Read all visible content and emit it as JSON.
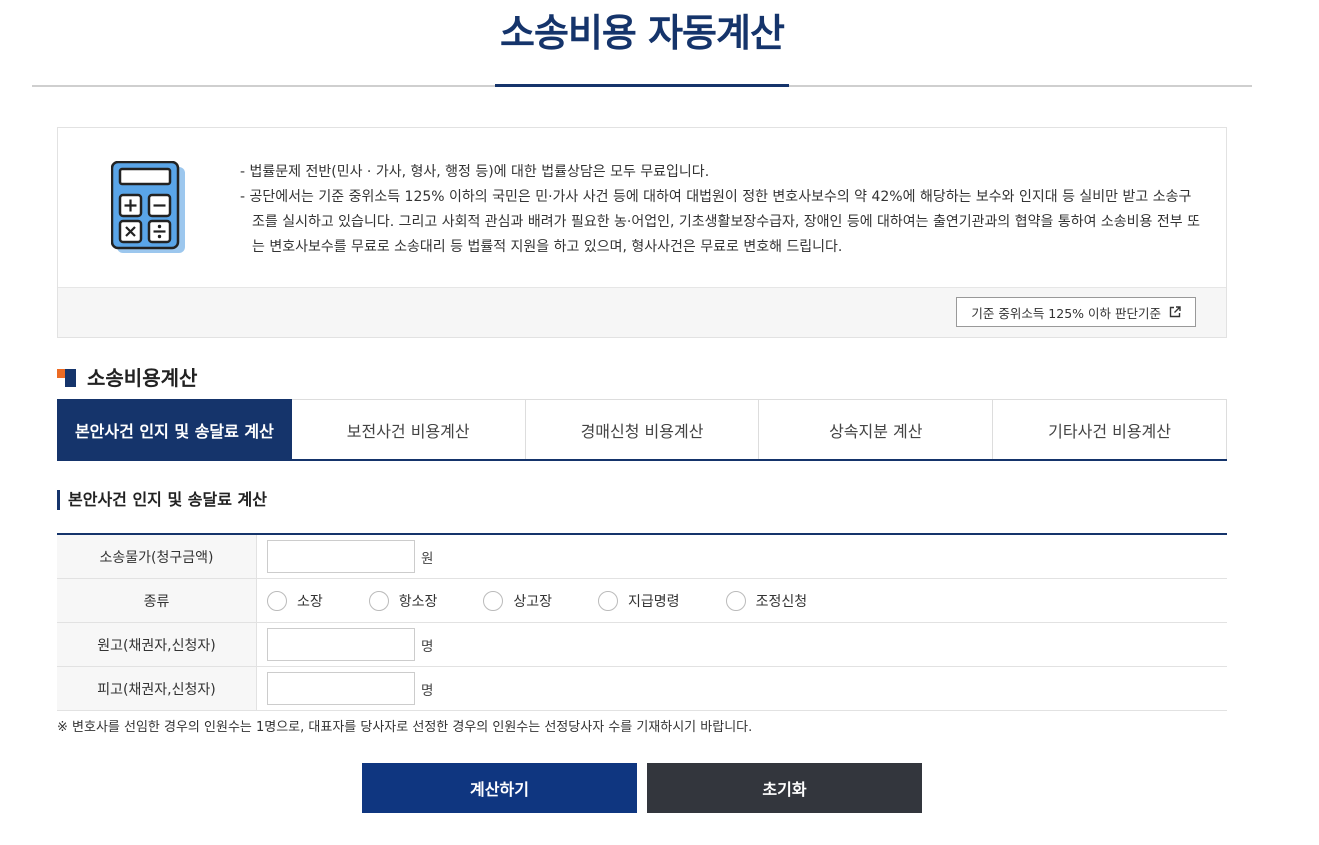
{
  "page": {
    "title": "소송비용 자동계산"
  },
  "info": {
    "line1": "법률문제 전반(민사 · 가사, 형사, 행정 등)에 대한 법률상담은 모두 무료입니다.",
    "line2": "공단에서는 기준 중위소득 125% 이하의 국민은 민·가사 사건 등에 대하여 대법원이 정한 변호사보수의 약 42%에 해당하는 보수와 인지대 등 실비만 받고 소송구조를 실시하고 있습니다. 그리고 사회적 관심과 배려가 필요한 농·어업인, 기초생활보장수급자, 장애인 등에 대하여는 출연기관과의 협약을 통하여 소송비용 전부 또는 변호사보수를 무료로 소송대리 등 법률적 지원을 하고 있으며, 형사사건은 무료로 변호해 드립니다.",
    "criteria_button": "기준 중위소득 125% 이하 판단기준",
    "icon": "calculator-icon",
    "link_icon": "external-link-icon"
  },
  "section": {
    "title": "소송비용계산"
  },
  "tabs": [
    {
      "label": "본안사건 인지 및 송달료 계산",
      "active": true
    },
    {
      "label": "보전사건 비용계산",
      "active": false
    },
    {
      "label": "경매신청 비용계산",
      "active": false
    },
    {
      "label": "상속지분 계산",
      "active": false
    },
    {
      "label": "기타사건 비용계산",
      "active": false
    }
  ],
  "form": {
    "subtitle": "본안사건 인지 및 송달료 계산",
    "claim_label": "소송물가(청구금액)",
    "claim_value": "",
    "claim_unit": "원",
    "type_label": "종류",
    "type_options": [
      "소장",
      "항소장",
      "상고장",
      "지급명령",
      "조정신청"
    ],
    "plaintiff_label": "원고(채권자,신청자)",
    "plaintiff_value": "",
    "plaintiff_unit": "명",
    "defendant_label": "피고(채권자,신청자)",
    "defendant_value": "",
    "defendant_unit": "명"
  },
  "notice": "※ 변호사를 선임한 경우의 인원수는 1명으로, 대표자를 당사자로 선정한 경우의 인원수는 선정당사자 수를 기재하시기 바랍니다.",
  "buttons": {
    "calculate": "계산하기",
    "reset": "초기화"
  },
  "colors": {
    "primary": "#15346b",
    "accent": "#ec6b24",
    "button_dark": "#33363d",
    "button_primary": "#0f3680"
  }
}
